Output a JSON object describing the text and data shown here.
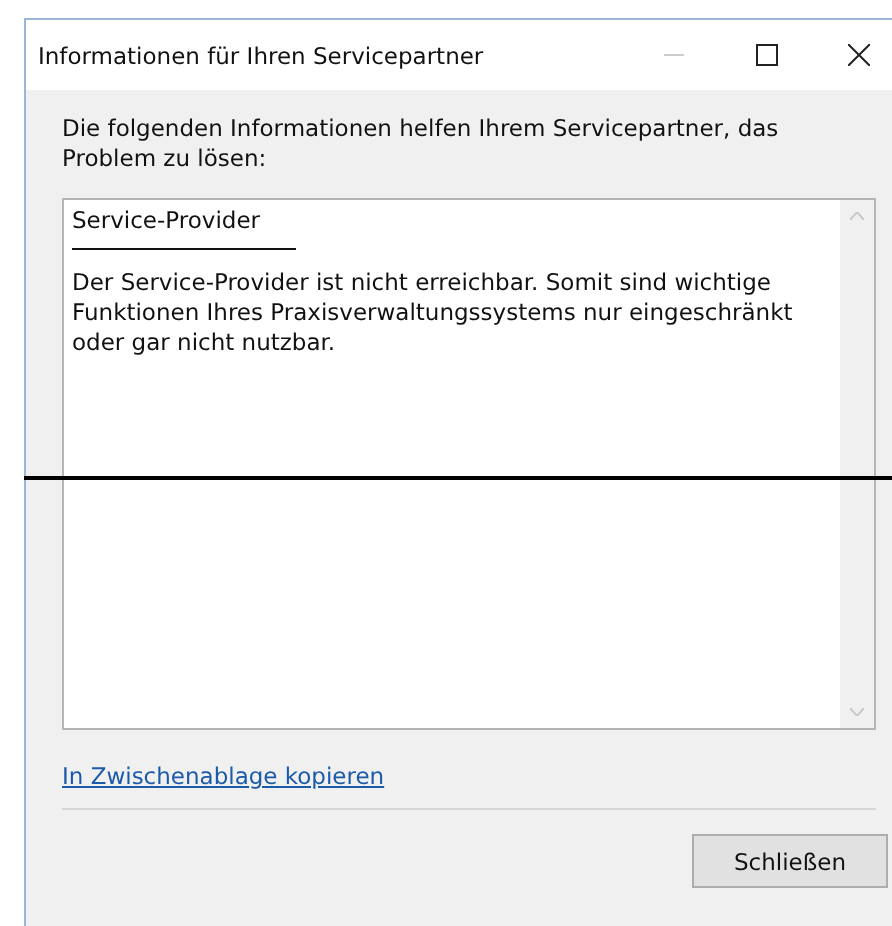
{
  "window": {
    "title": "Informationen für Ihren Servicepartner"
  },
  "intro": "Die folgenden Informationen helfen Ihrem Servicepartner, das Problem zu lösen:",
  "details": {
    "heading": "Service-Provider",
    "message": "Der Service-Provider ist nicht erreichbar. Somit sind wichtige Funktionen Ihres Praxisverwaltungssystems nur eingeschränkt oder gar nicht nutzbar."
  },
  "link": "In Zwischenablage kopieren",
  "buttons": [
    "Schließen"
  ]
}
